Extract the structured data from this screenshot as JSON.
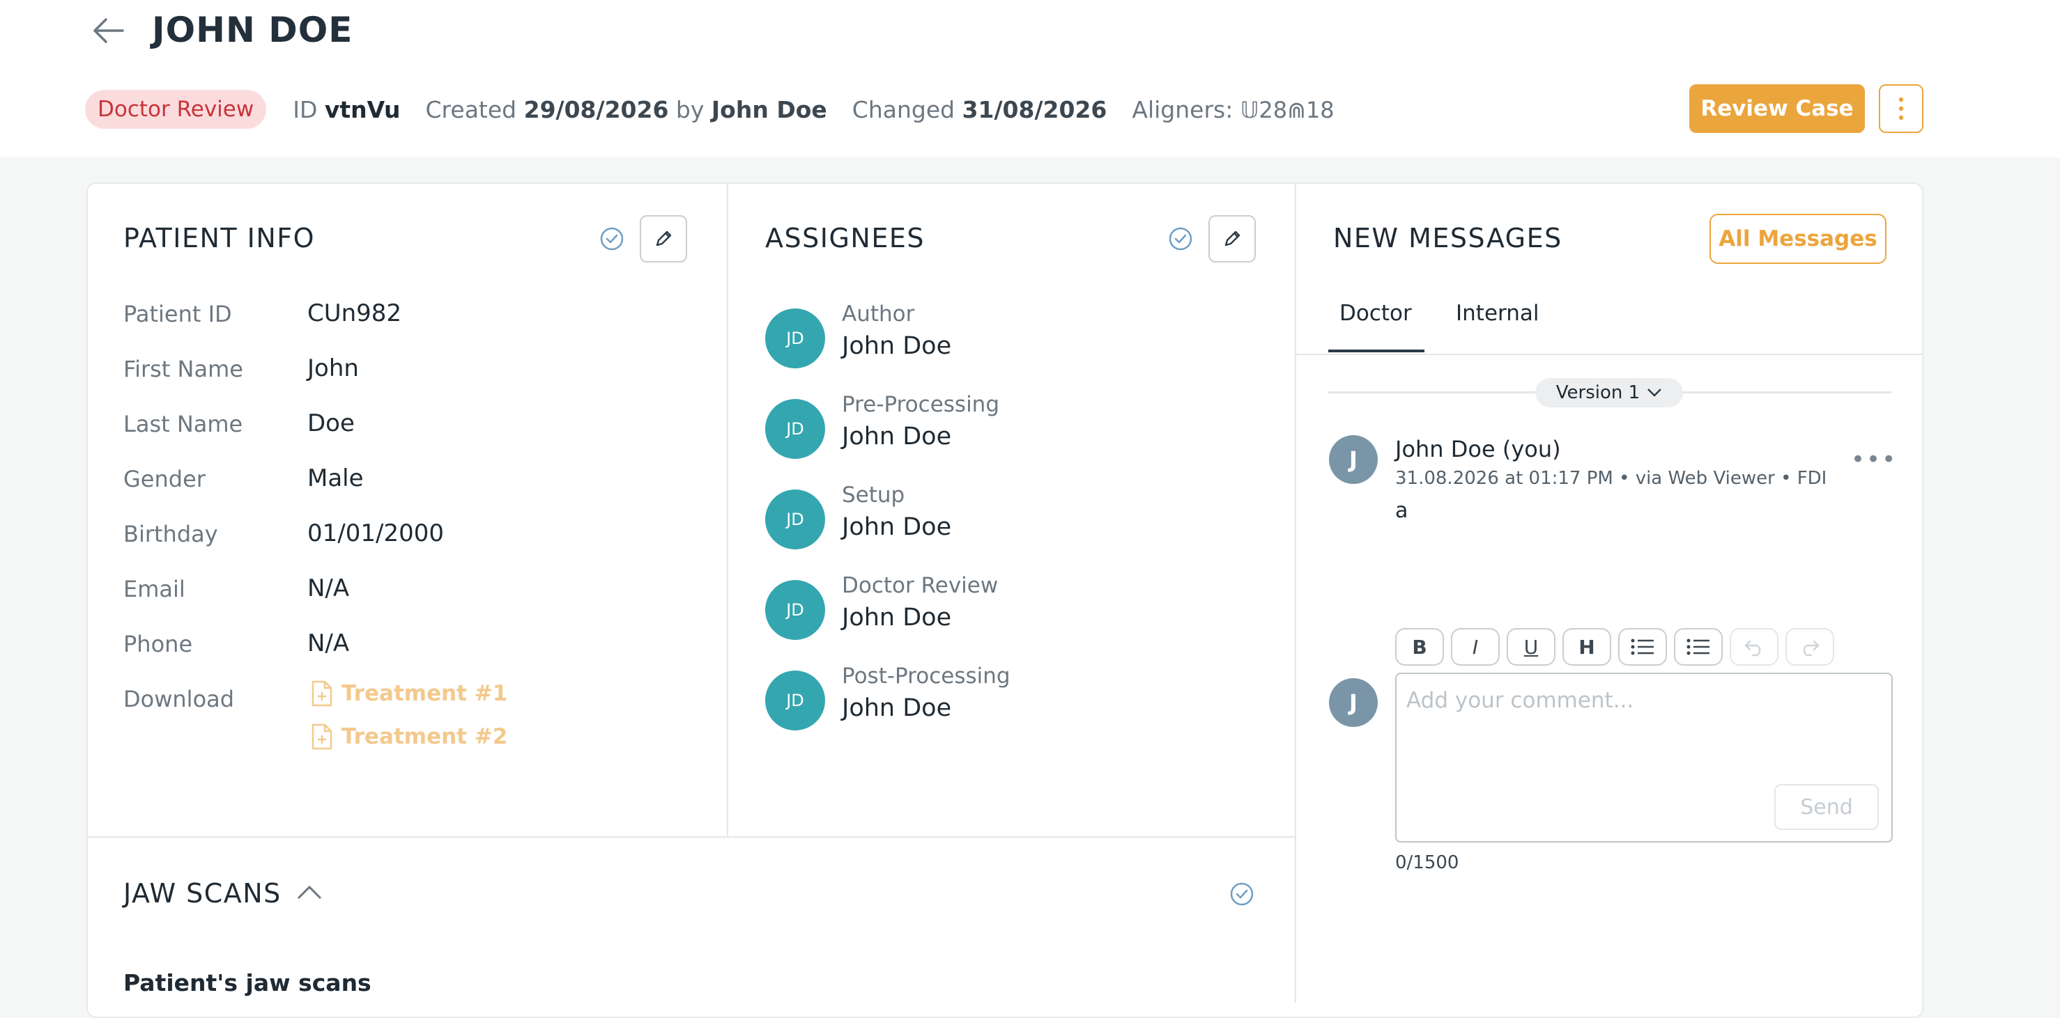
{
  "header": {
    "title": "JOHN DOE",
    "status": "Doctor Review",
    "id_label": "ID",
    "id_value": "vtnVu",
    "created_label": "Created",
    "created_date": "29/08/2026",
    "by_label": "by",
    "created_by": "John Doe",
    "changed_label": "Changed",
    "changed_date": "31/08/2026",
    "aligners_label": "Aligners:",
    "aligners_value": "𝕌28⋒18",
    "review_button": "Review Case",
    "accent_color": "#eba53d",
    "status_color": "#c8333a"
  },
  "patient_info": {
    "title": "PATIENT INFO",
    "fields": [
      {
        "label": "Patient ID",
        "value": "CUn982"
      },
      {
        "label": "First Name",
        "value": "John"
      },
      {
        "label": "Last Name",
        "value": "Doe"
      },
      {
        "label": "Gender",
        "value": "Male"
      },
      {
        "label": "Birthday",
        "value": "01/01/2000"
      },
      {
        "label": "Email",
        "value": "N/A"
      },
      {
        "label": "Phone",
        "value": "N/A"
      }
    ],
    "download_label": "Download",
    "downloads": [
      "Treatment #1",
      "Treatment #2"
    ]
  },
  "assignees": {
    "title": "ASSIGNEES",
    "items": [
      {
        "initials": "JD",
        "role": "Author",
        "name": "John Doe"
      },
      {
        "initials": "JD",
        "role": "Pre-Processing",
        "name": "John Doe"
      },
      {
        "initials": "JD",
        "role": "Setup",
        "name": "John Doe"
      },
      {
        "initials": "JD",
        "role": "Doctor Review",
        "name": "John Doe"
      },
      {
        "initials": "JD",
        "role": "Post-Processing",
        "name": "John Doe"
      }
    ]
  },
  "messages": {
    "title": "NEW MESSAGES",
    "all_button": "All Messages",
    "tabs": [
      "Doctor",
      "Internal"
    ],
    "active_tab": "Doctor",
    "version": "Version 1",
    "message": {
      "avatar": "J",
      "author": "John Doe (you)",
      "meta": "31.08.2026 at 01:17 PM • via Web Viewer • FDI",
      "body": "a"
    },
    "toolbar": [
      "B",
      "I",
      "U",
      "H"
    ],
    "composer_avatar": "J",
    "comment_placeholder": "Add your comment...",
    "send_button": "Send",
    "char_count": "0/1500"
  },
  "jaw_scans": {
    "title": "JAW SCANS",
    "subheading": "Patient's jaw scans"
  }
}
